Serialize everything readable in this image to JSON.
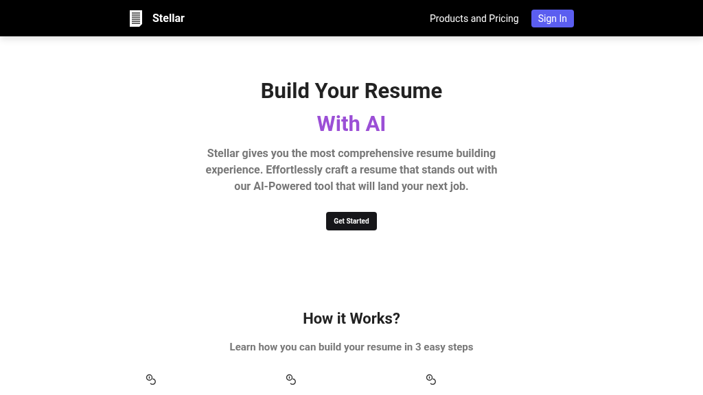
{
  "nav": {
    "brand": "Stellar",
    "links": [
      "Products and Pricing"
    ],
    "sign_in": "Sign In"
  },
  "hero": {
    "title": "Build Your Resume",
    "highlight": "With AI",
    "description": "Stellar gives you the most comprehensive resume building experience. Effortlessly craft a resume that stands out with our AI-Powered tool that will land your next job.",
    "cta": "Get Started"
  },
  "how": {
    "title": "How it Works?",
    "subtitle": "Learn how you can build your resume in 3 easy steps",
    "steps": [
      {
        "kind": "coins"
      },
      {
        "kind": "coins"
      },
      {
        "kind": "coins"
      }
    ]
  }
}
